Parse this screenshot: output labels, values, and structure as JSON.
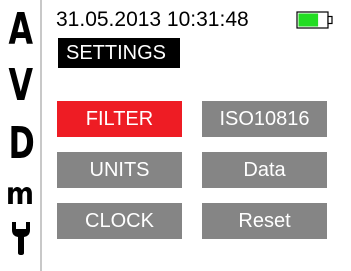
{
  "header": {
    "datetime": "31.05.2013 10:31:48",
    "battery": {
      "icon": "battery-icon",
      "charge_fraction": 0.7,
      "fill_color": "#22dd22"
    }
  },
  "page": {
    "title": "SETTINGS"
  },
  "mode_bar": {
    "items": [
      {
        "label": "A"
      },
      {
        "label": "V"
      },
      {
        "label": "D"
      },
      {
        "label": "m"
      }
    ],
    "tools_icon": "wrench-icon"
  },
  "menu": {
    "active_color": "#ee1c24",
    "default_color": "#858585",
    "buttons": [
      {
        "label": "FILTER",
        "active": true
      },
      {
        "label": "ISO10816",
        "active": false
      },
      {
        "label": "UNITS",
        "active": false
      },
      {
        "label": "Data",
        "active": false
      },
      {
        "label": "CLOCK",
        "active": false
      },
      {
        "label": "Reset",
        "active": false
      }
    ]
  }
}
